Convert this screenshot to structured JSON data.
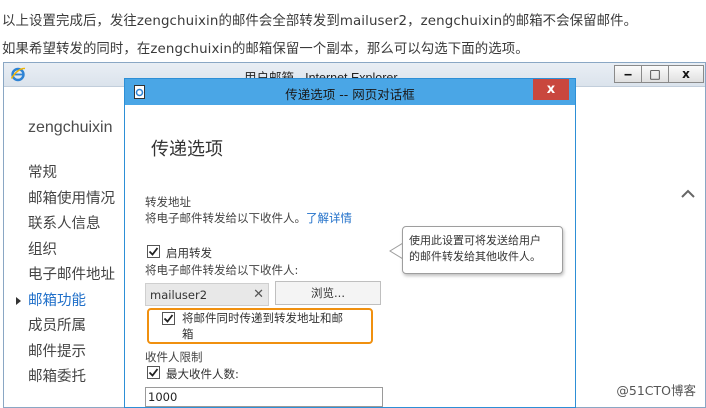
{
  "caption": {
    "line1": "以上设置完成后，发往zengchuixin的邮件会全部转发到mailuser2，zengchuixin的邮箱不会保留邮件。",
    "line2": "如果希望转发的同时，在zengchuixin的邮箱保留一个副本，那么可以勾选下面的选项。"
  },
  "ie_window": {
    "title": "用户邮箱 - Internet Explorer",
    "minimize": "‒",
    "maximize": "□",
    "close": "x"
  },
  "left_nav": {
    "account_name": "zengchuixin",
    "items": [
      {
        "label": "常规",
        "active": false
      },
      {
        "label": "邮箱使用情况",
        "active": false
      },
      {
        "label": "联系人信息",
        "active": false
      },
      {
        "label": "组织",
        "active": false
      },
      {
        "label": "电子邮件地址",
        "active": false
      },
      {
        "label": "邮箱功能",
        "active": true
      },
      {
        "label": "成员所属",
        "active": false
      },
      {
        "label": "邮件提示",
        "active": false
      },
      {
        "label": "邮箱委托",
        "active": false
      }
    ]
  },
  "dialog": {
    "title": "传递选项 -- 网页对话框",
    "close_label": "x",
    "heading": "传递选项",
    "forwarding_section": "转发地址",
    "forwarding_help": "将电子邮件转发给以下收件人。",
    "learn_more": "了解详情",
    "enable_forwarding_label": "启用转发",
    "enable_forwarding_checked": true,
    "forward_to_label": "将电子邮件转发给以下收件人:",
    "forward_recipient": "mailuser2",
    "remove_icon": "✕",
    "browse_button": "浏览...",
    "deliver_both_line1": "将邮件同时传递到转发地址和邮",
    "deliver_both_line2": "箱",
    "deliver_both_checked": true,
    "recipient_limit_section": "收件人限制",
    "max_recipients_label": "最大收件人数:",
    "max_recipients_checked": true,
    "max_recipients_value": "1000",
    "tooltip_line1": "使用此设置可将发送给用户",
    "tooltip_line2": "的邮件转发给其他收件人。"
  },
  "colors": {
    "dialog_titlebar": "#4aa6e6",
    "close_button": "#c9473e",
    "highlight": "#f0900f",
    "link": "#1f6fc9"
  },
  "watermark": "@51CTO博客"
}
